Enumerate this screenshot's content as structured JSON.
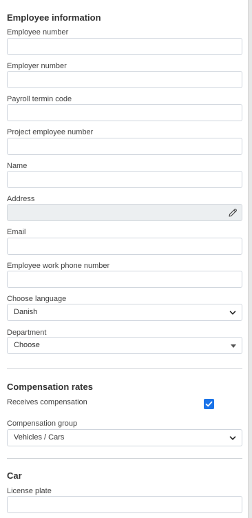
{
  "employee_section": {
    "title": "Employee information",
    "fields": {
      "employee_number": {
        "label": "Employee number",
        "value": ""
      },
      "employer_number": {
        "label": "Employer number",
        "value": ""
      },
      "payroll_termin_code": {
        "label": "Payroll termin code",
        "value": ""
      },
      "project_employee_number": {
        "label": "Project employee number",
        "value": ""
      },
      "name": {
        "label": "Name",
        "value": ""
      },
      "address": {
        "label": "Address",
        "value": ""
      },
      "email": {
        "label": "Email",
        "value": ""
      },
      "work_phone": {
        "label": "Employee work phone number",
        "value": ""
      },
      "language": {
        "label": "Choose language",
        "selected": "Danish"
      },
      "department": {
        "label": "Department",
        "selected": "Choose"
      }
    }
  },
  "compensation_section": {
    "title": "Compensation rates",
    "receives_compensation": {
      "label": "Receives compensation",
      "checked": true
    },
    "compensation_group": {
      "label": "Compensation group",
      "selected": "Vehicles / Cars"
    }
  },
  "car_section": {
    "title": "Car",
    "license_plate": {
      "label": "License plate",
      "value": ""
    }
  },
  "colors": {
    "accent": "#1a73e8",
    "input_border": "#cfd5dd",
    "disabled_bg": "#eceff1"
  },
  "icons": {
    "address_edit": "pencil-icon",
    "select_arrow": "chevron-down-icon",
    "dropdown_caret": "caret-down-icon",
    "checkbox": "check-icon"
  }
}
